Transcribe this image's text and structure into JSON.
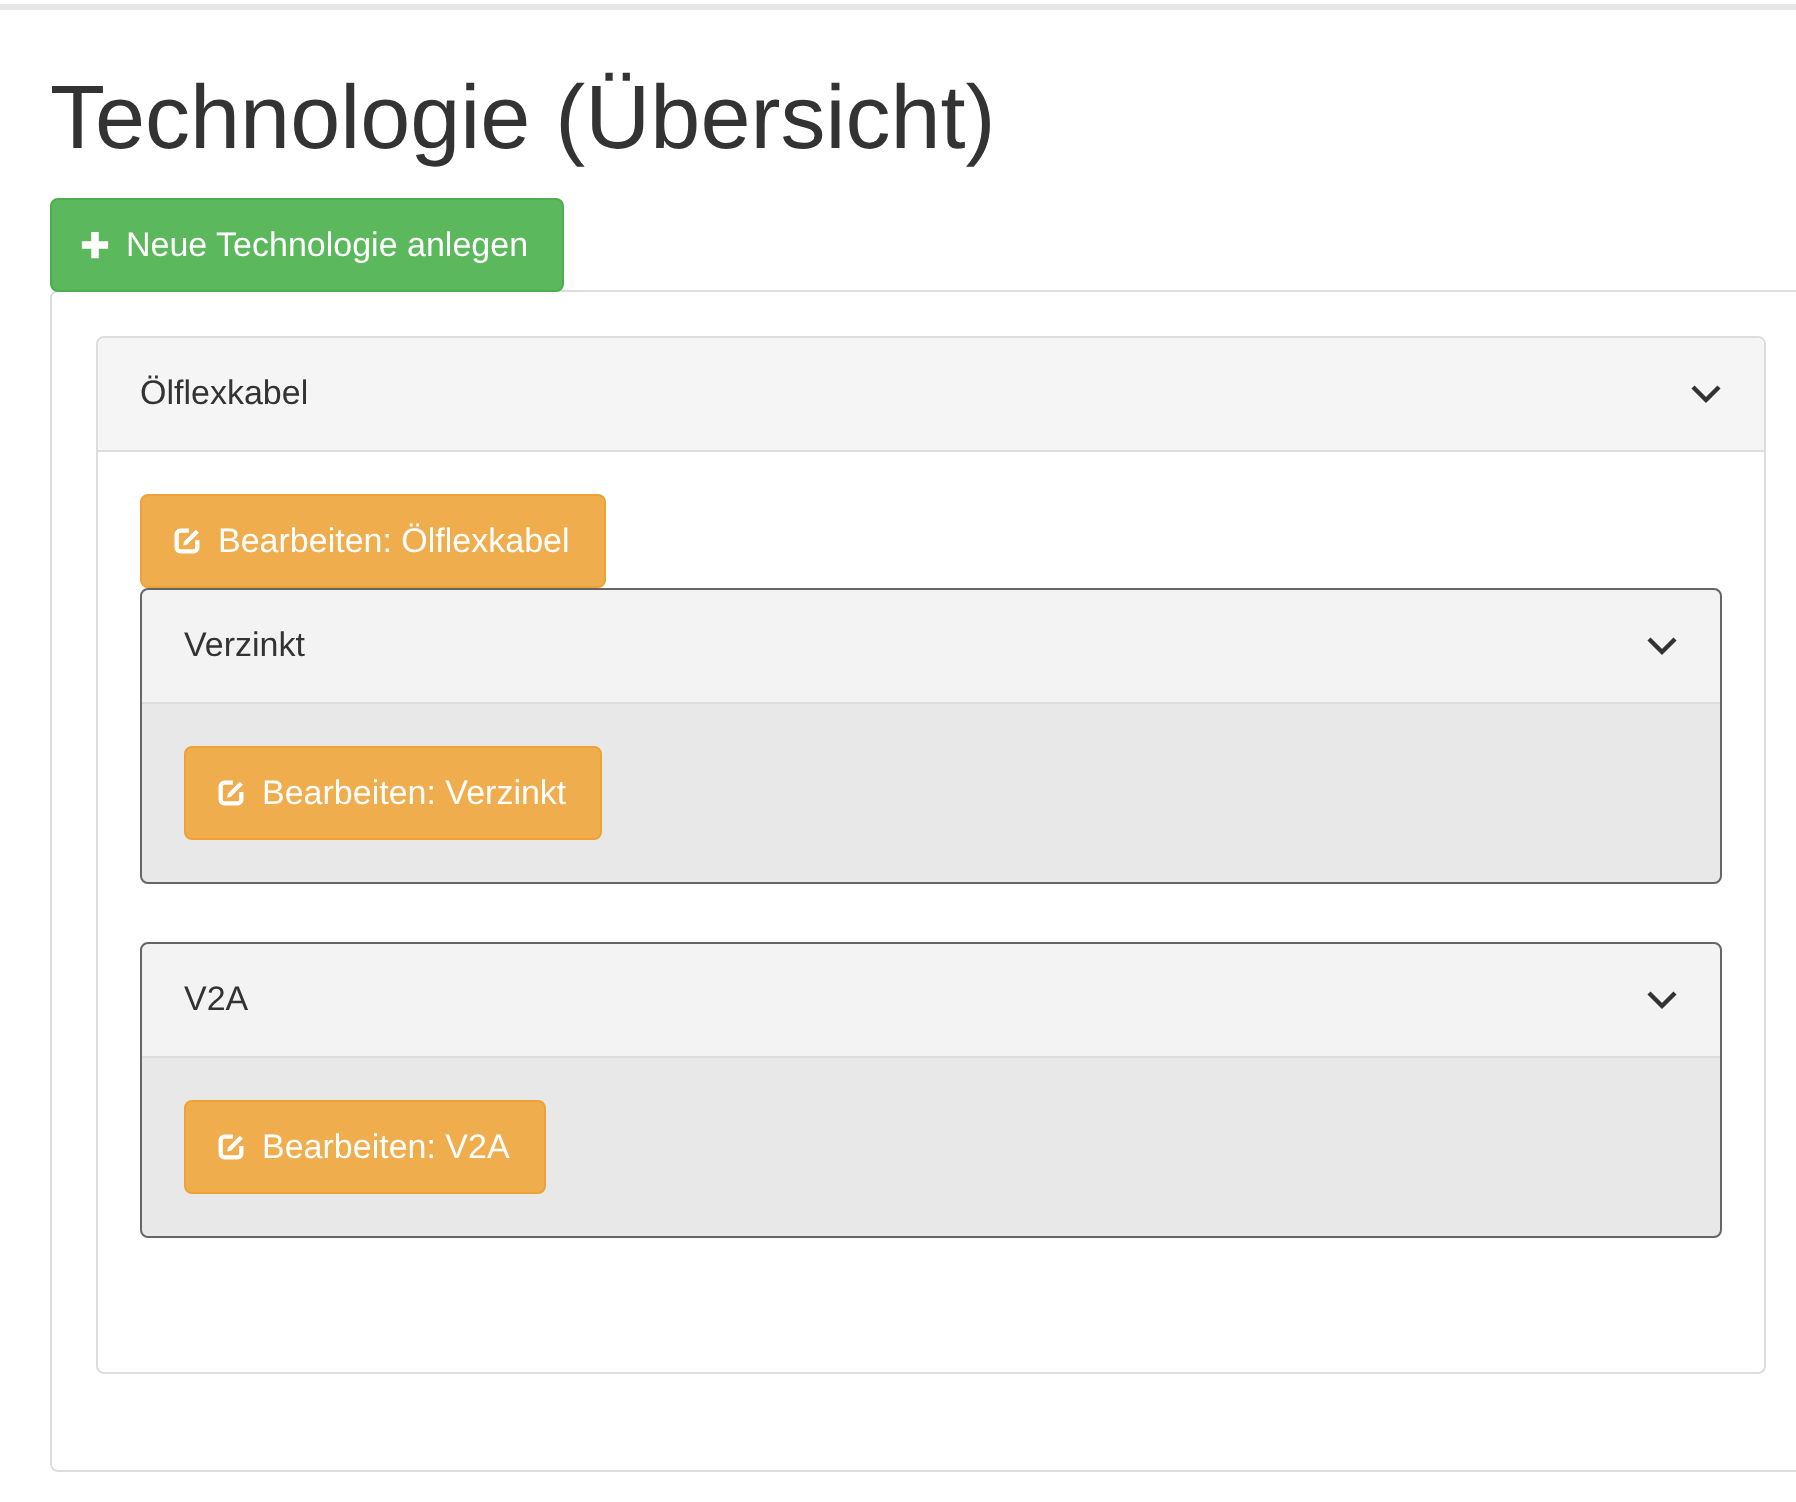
{
  "title": "Technologie (Übersicht)",
  "add_button": {
    "label": "Neue Technologie anlegen"
  },
  "technologies": [
    {
      "name": "Ölflexkabel",
      "expanded": true,
      "edit_button": "Bearbeiten: Ölflexkabel",
      "children": [
        {
          "name": "Verzinkt",
          "expanded": true,
          "edit_button": "Bearbeiten: Verzinkt"
        },
        {
          "name": "V2A",
          "expanded": true,
          "edit_button": "Bearbeiten: V2A"
        }
      ]
    }
  ]
}
